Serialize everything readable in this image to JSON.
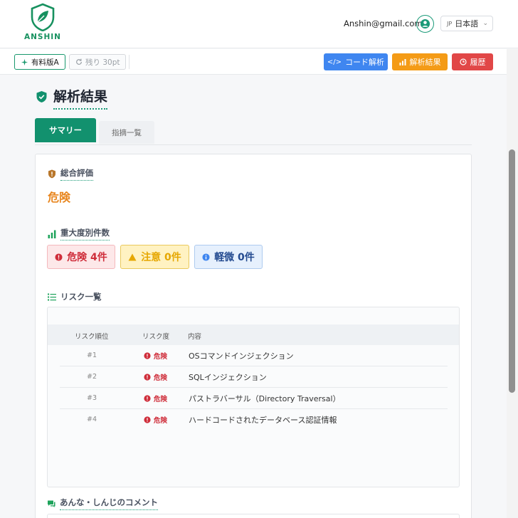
{
  "header": {
    "brand": "ANSHIN",
    "email": "Anshin@gmail.com",
    "lang_code": "JP",
    "lang_label": "日本語"
  },
  "toolbar": {
    "plan_label": "有料版A",
    "remaining_label": "残り 30pt",
    "code_analysis": "コード解析",
    "analysis_result": "解析結果",
    "history": "履歴"
  },
  "page": {
    "title": "解析結果",
    "tabs": [
      {
        "label": "サマリー",
        "active": true
      },
      {
        "label": "指摘一覧",
        "active": false
      }
    ]
  },
  "summary": {
    "overall_label": "総合評価",
    "overall_value": "危険",
    "severity_label": "重大度別件数",
    "counts": {
      "danger": "危険 4件",
      "warning": "注意 0件",
      "minor": "軽微 0件"
    },
    "risk_list_label": "リスク一覧",
    "table_headers": [
      "リスク順位",
      "リスク度",
      "内容"
    ],
    "rows": [
      {
        "rank": "#1",
        "severity": "危険",
        "content": "OSコマンドインジェクション"
      },
      {
        "rank": "#2",
        "severity": "危険",
        "content": "SQLインジェクション"
      },
      {
        "rank": "#3",
        "severity": "危険",
        "content": "パストラバーサル（Directory Traversal）"
      },
      {
        "rank": "#4",
        "severity": "危険",
        "content": "ハードコードされたデータベース認証情報"
      }
    ],
    "comment_label": "あんな・しんじのコメント"
  },
  "colors": {
    "brand_green": "#12916e",
    "danger": "#cf2d3a",
    "warning": "#e6a700",
    "info": "#234a90",
    "overall_orange": "#e8861f"
  }
}
